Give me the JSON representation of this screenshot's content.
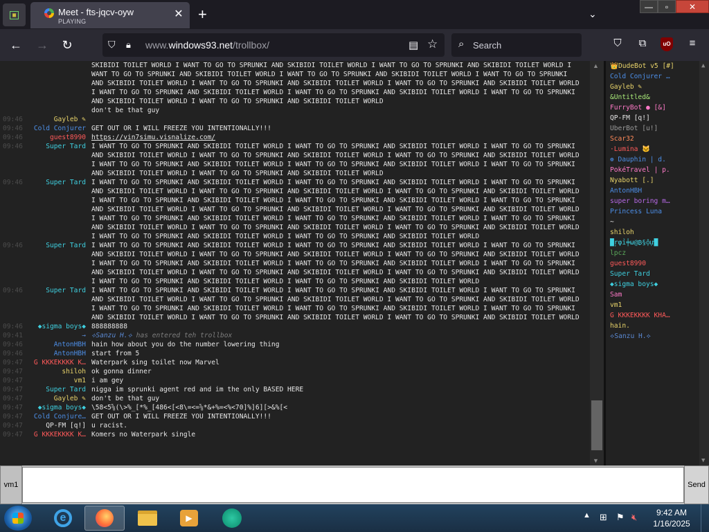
{
  "browser": {
    "tab": {
      "title": "Meet - fts-jqcv-oyw",
      "subtitle": "PLAYING"
    },
    "url": {
      "prefix": "www.",
      "domain": "windows93.net",
      "path": "/trollbox/"
    },
    "search_placeholder": "Search",
    "ublock_label": "uO"
  },
  "colors": {
    "nick_cyan": "#3fd0e0",
    "nick_yellow": "#e8d36a",
    "nick_blue": "#4d8fe8",
    "nick_red": "#ff5a5a",
    "time": "#4c4c4c"
  },
  "chat": {
    "messages": [
      {
        "time": "",
        "nick": "",
        "color": "#e6e6e6",
        "text": "SKIBIDI TOILET WORLD I WANT TO GO TO SPRUNKI AND SKIBIDI TOILET WORLD I WANT TO GO TO SPRUNKI AND SKIBIDI TOILET WORLD I WANT TO GO TO SPRUNKI AND SKIBIDI TOILET WORLD I WANT TO GO TO SPRUNKI AND SKIBIDI TOILET WORLD I WANT TO GO TO SPRUNKI AND SKIBIDI TOILET WORLD I WANT TO GO TO SPRUNKI AND SKIBIDI TOILET WORLD I WANT TO GO TO SPRUNKI AND SKIBIDI TOILET WORLD I WANT TO GO TO SPRUNKI AND SKIBIDI TOILET WORLD I WANT TO GO TO SPRUNKI AND SKIBIDI TOILET WORLD I WANT TO GO TO SPRUNKI AND SKIBIDI TOILET WORLD I WANT TO GO TO SPRUNKI AND SKIBIDI TOILET WORLD",
        "type": "text"
      },
      {
        "time": "",
        "nick": "",
        "color": "#e6e6e6",
        "text": "don't be that guy",
        "type": "text"
      },
      {
        "time": "09:46",
        "nick": "Gayleb ✎",
        "color": "#e8d36a",
        "text": "",
        "type": "text"
      },
      {
        "time": "09:46",
        "nick": "Cold Conjurer",
        "color": "#4d8fe8",
        "text": "GET OUT OR I WILL FREEZE YOU INTENTIONALLY!!!",
        "type": "text"
      },
      {
        "time": "09:46",
        "nick": "guest8990",
        "color": "#ff5a5a",
        "text": "https://vin7simu.visnalize.com/",
        "type": "link"
      },
      {
        "time": "09:46",
        "nick": "Super Tard",
        "color": "#3fd0e0",
        "text": "I WANT TO GO TO SPRUNKI AND SKIBIDI TOILET WORLD I WANT TO GO TO SPRUNKI AND SKIBIDI TOILET WORLD I WANT TO GO TO SPRUNKI AND SKIBIDI TOILET WORLD I WANT TO GO TO SPRUNKI AND SKIBIDI TOILET WORLD I WANT TO GO TO SPRUNKI AND SKIBIDI TOILET WORLD I WANT TO GO TO SPRUNKI AND SKIBIDI TOILET WORLD I WANT TO GO TO SPRUNKI AND SKIBIDI TOILET WORLD I WANT TO GO TO SPRUNKI AND SKIBIDI TOILET WORLD I WANT TO GO TO SPRUNKI AND SKIBIDI TOILET WORLD",
        "type": "text"
      },
      {
        "time": "09:46",
        "nick": "Super Tard",
        "color": "#3fd0e0",
        "text": "I WANT TO GO TO SPRUNKI AND SKIBIDI TOILET WORLD I WANT TO GO TO SPRUNKI AND SKIBIDI TOILET WORLD I WANT TO GO TO SPRUNKI AND SKIBIDI TOILET WORLD I WANT TO GO TO SPRUNKI AND SKIBIDI TOILET WORLD I WANT TO GO TO SPRUNKI AND SKIBIDI TOILET WORLD I WANT TO GO TO SPRUNKI AND SKIBIDI TOILET WORLD I WANT TO GO TO SPRUNKI AND SKIBIDI TOILET WORLD I WANT TO GO TO SPRUNKI AND SKIBIDI TOILET WORLD I WANT TO GO TO SPRUNKI AND SKIBIDI TOILET WORLD I WANT TO GO TO SPRUNKI AND SKIBIDI TOILET WORLD I WANT TO GO TO SPRUNKI AND SKIBIDI TOILET WORLD I WANT TO GO TO SPRUNKI AND SKIBIDI TOILET WORLD I WANT TO GO TO SPRUNKI AND SKIBIDI TOILET WORLD I WANT TO GO TO SPRUNKI AND SKIBIDI TOILET WORLD I WANT TO GO TO SPRUNKI AND SKIBIDI TOILET WORLD I WANT TO GO TO SPRUNKI AND SKIBIDI TOILET WORLD I WANT TO GO TO SPRUNKI AND SKIBIDI TOILET WORLD",
        "type": "text"
      },
      {
        "time": "09:46",
        "nick": "Super Tard",
        "color": "#3fd0e0",
        "text": "I WANT TO GO TO SPRUNKI AND SKIBIDI TOILET WORLD I WANT TO GO TO SPRUNKI AND SKIBIDI TOILET WORLD I WANT TO GO TO SPRUNKI AND SKIBIDI TOILET WORLD I WANT TO GO TO SPRUNKI AND SKIBIDI TOILET WORLD I WANT TO GO TO SPRUNKI AND SKIBIDI TOILET WORLD I WANT TO GO TO SPRUNKI AND SKIBIDI TOILET WORLD I WANT TO GO TO SPRUNKI AND SKIBIDI TOILET WORLD I WANT TO GO TO SPRUNKI AND SKIBIDI TOILET WORLD I WANT TO GO TO SPRUNKI AND SKIBIDI TOILET WORLD I WANT TO GO TO SPRUNKI AND SKIBIDI TOILET WORLD I WANT TO GO TO SPRUNKI AND SKIBIDI TOILET WORLD I WANT TO GO TO SPRUNKI AND SKIBIDI TOILET WORLD",
        "type": "text"
      },
      {
        "time": "09:46",
        "nick": "Super Tard",
        "color": "#3fd0e0",
        "text": "I WANT TO GO TO SPRUNKI AND SKIBIDI TOILET WORLD I WANT TO GO TO SPRUNKI AND SKIBIDI TOILET WORLD I WANT TO GO TO SPRUNKI AND SKIBIDI TOILET WORLD I WANT TO GO TO SPRUNKI AND SKIBIDI TOILET WORLD I WANT TO GO TO SPRUNKI AND SKIBIDI TOILET WORLD I WANT TO GO TO SPRUNKI AND SKIBIDI TOILET WORLD I WANT TO GO TO SPRUNKI AND SKIBIDI TOILET WORLD I WANT TO GO TO SPRUNKI AND SKIBIDI TOILET WORLD I WANT TO GO TO SPRUNKI AND SKIBIDI TOILET WORLD I WANT TO GO TO SPRUNKI AND SKIBIDI TOILET WORLD",
        "type": "text"
      },
      {
        "time": "09:46",
        "nick": "◆sigma boys◆",
        "color": "#3fd0e0",
        "text": "888888888",
        "type": "text"
      },
      {
        "time": "09:41",
        "nick": "→",
        "color": "#5a88d1",
        "text": "has entered teh trollbox",
        "who": "⟡Sanzu H.⟡",
        "type": "sys"
      },
      {
        "time": "09:46",
        "nick": "AntonHBH",
        "color": "#4d8fe8",
        "text": "hain how about you do the number lowering thing",
        "type": "text"
      },
      {
        "time": "09:46",
        "nick": "AntonHBH",
        "color": "#4d8fe8",
        "text": "start from 5",
        "type": "text"
      },
      {
        "time": "09:47",
        "nick": "G KKKEKKKK K…",
        "color": "#ff5a5a",
        "text": "Waterpark sing toilet now Marvel",
        "type": "text"
      },
      {
        "time": "09:47",
        "nick": "shiloh",
        "color": "#e8d36a",
        "text": "ok gonna dinner",
        "type": "text"
      },
      {
        "time": "09:47",
        "nick": "vm1",
        "color": "#e8d36a",
        "text": "i am gey",
        "type": "text"
      },
      {
        "time": "09:47",
        "nick": "Super Tard",
        "color": "#3fd0e0",
        "text": "nigga im sprunki agent red and im the only BASED HERE",
        "type": "text"
      },
      {
        "time": "09:47",
        "nick": "Gayleb ✎",
        "color": "#e8d36a",
        "text": "don't be that guy",
        "type": "text"
      },
      {
        "time": "09:47",
        "nick": "◆sigma boys◆",
        "color": "#3fd0e0",
        "text": "\\58<5⅝(\\>%_[*%_[486<[<8\\=<=⅝*&+%=<%<70]%]6][>&%[<",
        "type": "text"
      },
      {
        "time": "09:47",
        "nick": "Cold Conjure…",
        "color": "#4d8fe8",
        "text": "GET OUT OR I WILL FREEZE YOU INTENTIONALLY!!!",
        "type": "text"
      },
      {
        "time": "09:47",
        "nick": "QP-FM [q!]",
        "color": "#e6e6e6",
        "text": "u racist.",
        "type": "text"
      },
      {
        "time": "09:47",
        "nick": "G KKKEKKKK K…",
        "color": "#ff5a5a",
        "text": "Komers no Waterpark single",
        "type": "text"
      }
    ]
  },
  "users": [
    {
      "name": "👑DudeBot v5 [#]",
      "color": "#e8d36a"
    },
    {
      "name": "Cold Conjurer …",
      "color": "#4d8fe8"
    },
    {
      "name": "Gayleb ✎",
      "color": "#e8d36a"
    },
    {
      "name": "&Untitled&",
      "color": "#a8e878"
    },
    {
      "name": "FurryBot ● [&]",
      "color": "#ff7ac8"
    },
    {
      "name": "QP-FM [q!]",
      "color": "#e6e6e6"
    },
    {
      "name": "UberBot [u!]",
      "color": "#9a9a9a"
    },
    {
      "name": "Scar32",
      "color": "#ff8a5a"
    },
    {
      "name": "·Lumina 🐱",
      "color": "#ff5a5a"
    },
    {
      "name": "❁ Dauphin | d.",
      "color": "#4d8fe8"
    },
    {
      "name": "PokéTravel | p.",
      "color": "#ff7ac8"
    },
    {
      "name": "Nyabott [.]",
      "color": "#e8d36a"
    },
    {
      "name": "AntonHBH",
      "color": "#4d8fe8"
    },
    {
      "name": "super boring m…",
      "color": "#b86ae8"
    },
    {
      "name": "Princess Luna",
      "color": "#4d8fe8"
    },
    {
      "name": "~",
      "color": "#e6e6e6"
    },
    {
      "name": "shiloh",
      "color": "#e8d36a"
    },
    {
      "name": "█ŗφỉ╪ω@₿§ộự█",
      "color": "#3fd0e0"
    },
    {
      "name": "lpcz",
      "color": "#5aa85a"
    },
    {
      "name": "guest8990",
      "color": "#ff5a5a"
    },
    {
      "name": "Super Tard",
      "color": "#3fd0e0"
    },
    {
      "name": "◆sigma boys◆",
      "color": "#3fd0e0"
    },
    {
      "name": "Sam",
      "color": "#ff7ac8"
    },
    {
      "name": "vm1",
      "color": "#e8d36a"
    },
    {
      "name": "G KKKEKKKK KHA…",
      "color": "#ff5a5a"
    },
    {
      "name": "hain.",
      "color": "#e8d36a"
    },
    {
      "name": "⟡Sanzu H.⟡",
      "color": "#5a88d1"
    }
  ],
  "input": {
    "nick_label": "vm1",
    "send_label": "Send",
    "value": ""
  },
  "taskbar": {
    "time": "9:42 AM",
    "date": "1/16/2025"
  }
}
